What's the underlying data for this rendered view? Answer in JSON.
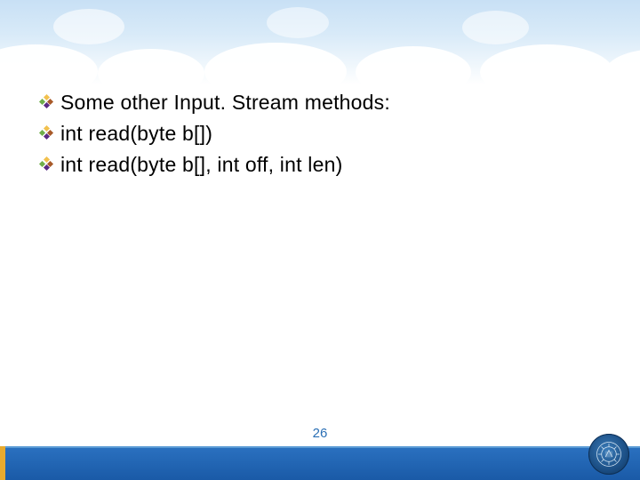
{
  "slide": {
    "bullets": [
      {
        "text": "Some other Input. Stream methods:"
      },
      {
        "text": "int read(byte b[])"
      },
      {
        "text": "int read(byte b[], int off, int len)"
      }
    ],
    "page_number": "26"
  },
  "colors": {
    "footer_gradient_top": "#2a70bf",
    "footer_gradient_bottom": "#1a5aa7",
    "accent_gold": "#e8aa2e",
    "page_num": "#2a6fb5"
  }
}
